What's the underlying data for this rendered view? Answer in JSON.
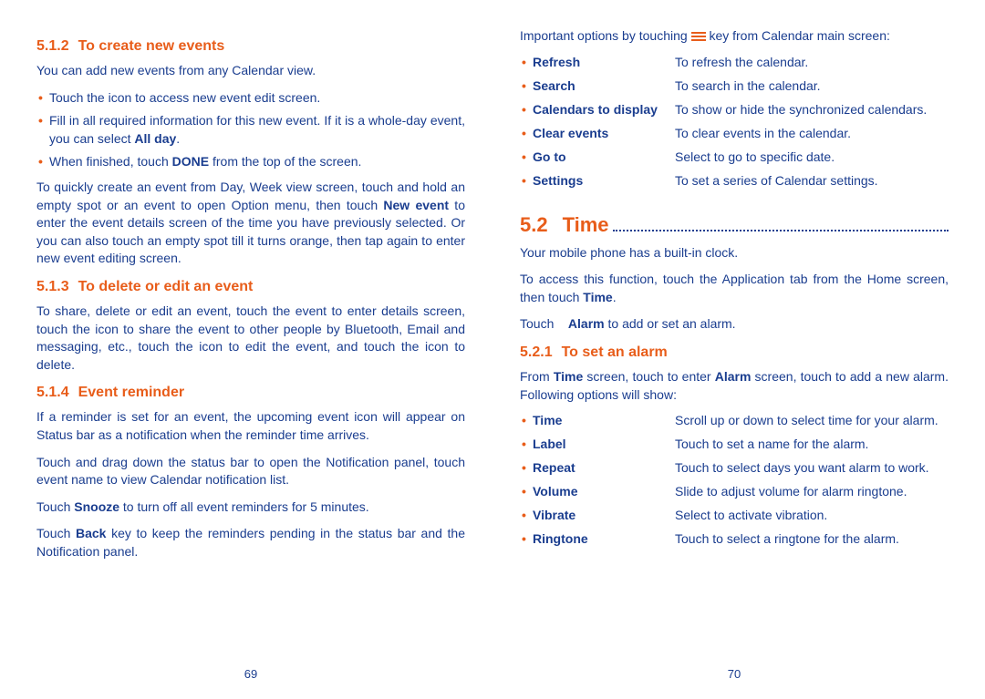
{
  "left": {
    "s1": {
      "num": "5.1.2",
      "title": "To create new events",
      "p1": "You can add new events from any Calendar view.",
      "b1a": "Touch the icon ",
      "b1b": " to access new event edit screen.",
      "b2a": "Fill in all required information for this new event. If it is a whole-day event, you can select ",
      "b2b": "All day",
      "b2c": ".",
      "b3a": "When finished, touch ",
      "b3b": "DONE",
      "b3c": " from the top of the screen.",
      "p2a": "To quickly create an event from Day, Week view screen, touch and hold an empty spot or an event to open Option menu, then touch ",
      "p2b": "New event",
      "p2c": " to enter the event details screen of the time you have previously selected. Or you can also touch an empty spot till it turns orange, then tap again to enter new event editing screen."
    },
    "s2": {
      "num": "5.1.3",
      "title": "To delete or edit an event",
      "p1": "To share, delete or edit an event, touch the event to enter details screen, touch the icon   to share the event to other people by Bluetooth, Email and messaging, etc., touch the icon   to edit the event, and touch the icon   to delete."
    },
    "s3": {
      "num": "5.1.4",
      "title": "Event reminder",
      "p1": "If a reminder is set for an event, the upcoming event icon   will appear on Status bar as a notification when the reminder time arrives.",
      "p2": "Touch and drag down the status bar to open the Notification panel, touch event name to view Calendar notification list.",
      "p3a": "Touch ",
      "p3b": "Snooze",
      "p3c": " to turn off all event reminders for 5 minutes.",
      "p4a": "Touch ",
      "p4b": "Back",
      "p4c": " key to keep the reminders pending in the status bar and the Notification panel."
    },
    "page": "69"
  },
  "right": {
    "intro": "Important options by touching ",
    "intro2": " key from Calendar main screen:",
    "opts": [
      {
        "k": "Refresh",
        "v": "To refresh the calendar."
      },
      {
        "k": "Search",
        "v": "To search in the calendar."
      },
      {
        "k": "Calendars to display",
        "v": "To show or hide the synchronized calendars."
      },
      {
        "k": "Clear events",
        "v": "To clear events in the calendar."
      },
      {
        "k": "Go to",
        "v": "Select to go to specific date."
      },
      {
        "k": "Settings",
        "v": "To set a series of Calendar settings."
      }
    ],
    "h2num": "5.2",
    "h2title": "Time",
    "p1": "Your mobile phone has a built-in clock.",
    "p2a": "To access this function, touch the Application tab from the Home screen, then touch ",
    "p2b": "Time",
    "p2c": ".",
    "p3a": "Touch ",
    "p3b": "Alarm",
    "p3c": " to add or set an alarm.",
    "s1": {
      "num": "5.2.1",
      "title": "To set an alarm",
      "p1a": "From ",
      "p1b": "Time",
      "p1c": " screen, touch   to enter ",
      "p1d": "Alarm",
      "p1e": " screen, touch   to add a new alarm. Following options will show:"
    },
    "opts2": [
      {
        "k": "Time",
        "v": "Scroll up or down to select time for your alarm."
      },
      {
        "k": "Label",
        "v": "Touch to set a name for the alarm."
      },
      {
        "k": "Repeat",
        "v": "Touch to select days you want alarm to work."
      },
      {
        "k": "Volume",
        "v": "Slide to adjust volume for alarm ringtone."
      },
      {
        "k": "Vibrate",
        "v": "Select to activate vibration."
      },
      {
        "k": "Ringtone",
        "v": "Touch to select a ringtone for the alarm."
      }
    ],
    "page": "70"
  }
}
